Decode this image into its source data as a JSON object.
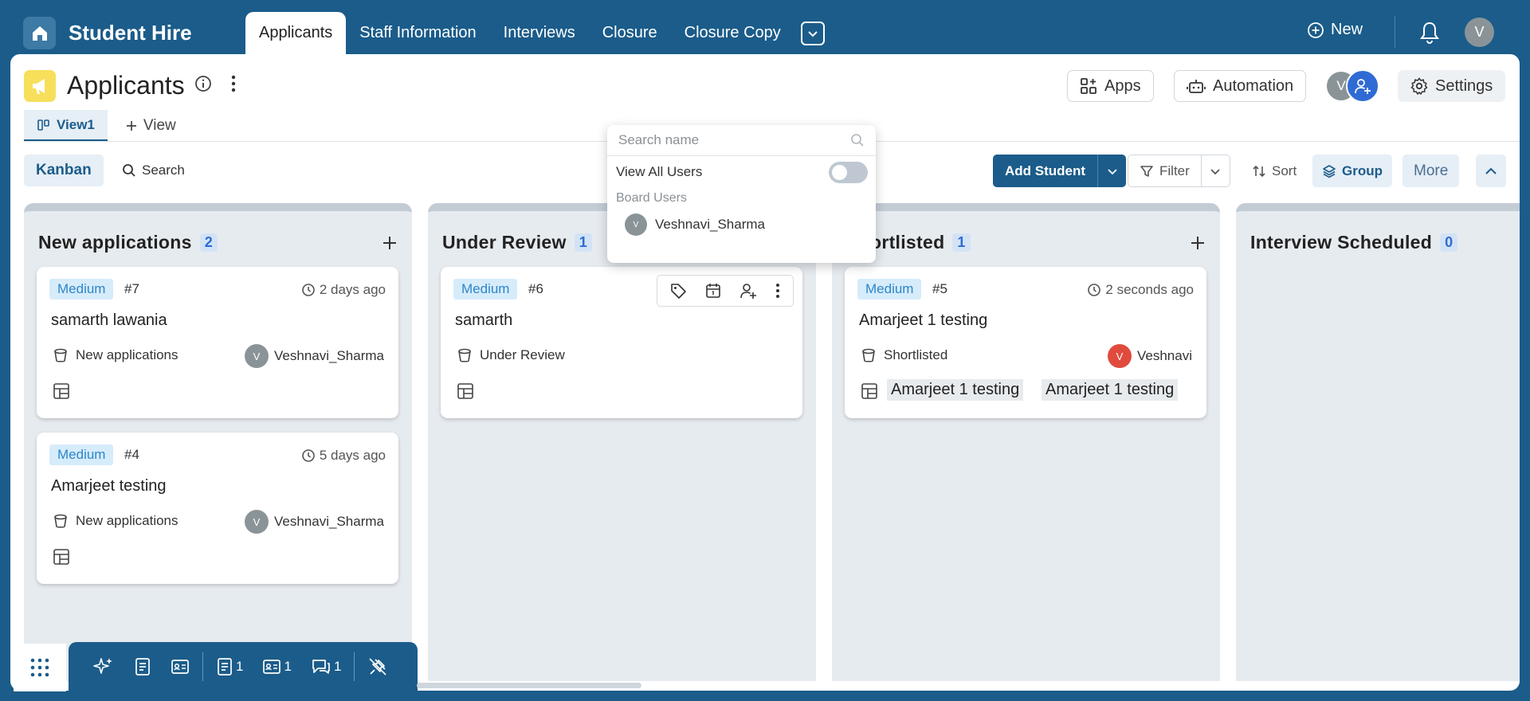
{
  "app": {
    "title": "Student Hire"
  },
  "topnav": {
    "tabs": [
      {
        "label": "Applicants",
        "active": true
      },
      {
        "label": "Staff Information"
      },
      {
        "label": "Interviews"
      },
      {
        "label": "Closure"
      },
      {
        "label": "Closure Copy"
      }
    ],
    "new_label": "New",
    "avatar_initial": "V"
  },
  "page": {
    "title": "Applicants",
    "apps_label": "Apps",
    "automation_label": "Automation",
    "settings_label": "Settings",
    "member_initial": "V"
  },
  "views": {
    "active": "View1",
    "add_label": "View"
  },
  "toolbar": {
    "kanban_label": "Kanban",
    "search_label": "Search",
    "add_student_label": "Add Student",
    "filter_label": "Filter",
    "sort_label": "Sort",
    "group_label": "Group",
    "more_label": "More"
  },
  "user_dropdown": {
    "search_placeholder": "Search name",
    "view_all_label": "View All Users",
    "view_all_on": false,
    "section_label": "Board Users",
    "users": [
      {
        "initial": "V",
        "name": "Veshnavi_Sharma"
      }
    ]
  },
  "columns": [
    {
      "title": "New applications",
      "count": "2",
      "cards": [
        {
          "priority": "Medium",
          "number": "#7",
          "time": "2 days ago",
          "name": "samarth lawania",
          "stage": "New applications",
          "user_initial": "V",
          "user": "Veshnavi_Sharma"
        },
        {
          "priority": "Medium",
          "number": "#4",
          "time": "5 days ago",
          "name": "Amarjeet testing",
          "stage": "New applications",
          "user_initial": "V",
          "user": "Veshnavi_Sharma"
        }
      ]
    },
    {
      "title": "Under Review",
      "count": "1",
      "cards": [
        {
          "priority": "Medium",
          "number": "#6",
          "name": "samarth",
          "stage": "Under Review"
        }
      ]
    },
    {
      "title": "Shortlisted",
      "count": "1",
      "cards": [
        {
          "priority": "Medium",
          "number": "#5",
          "time": "2 seconds ago",
          "name": "Amarjeet 1 testing",
          "stage": "Shortlisted",
          "user_initial": "V",
          "user": "Veshnavi",
          "chips": [
            "Amarjeet 1 testing",
            "Amarjeet 1 testing"
          ]
        }
      ]
    },
    {
      "title": "Interview Scheduled",
      "count": "0",
      "cards": []
    }
  ],
  "bottom_bar": {
    "doc_count": "1",
    "card_count": "1",
    "comment_count": "1"
  },
  "colors": {
    "brand": "#1b5c8a",
    "accent_blue": "#2f6bd4",
    "priority_text": "#2e86c8",
    "avatar_red": "#e04b3d",
    "page_icon_yellow": "#f7df5c"
  },
  "icons": [
    "home-icon",
    "chevron-down-icon",
    "plus-circle-icon",
    "bell-icon",
    "megaphone-icon",
    "info-icon",
    "kebab-icon",
    "apps-icon",
    "robot-icon",
    "add-user-icon",
    "gear-icon",
    "kanban-icon",
    "plus-icon",
    "search-icon",
    "filter-icon",
    "sort-icon",
    "layers-icon",
    "chevron-up-icon",
    "clock-icon",
    "bucket-icon",
    "table-icon",
    "tag-icon",
    "calendar-icon",
    "grid-dots-icon",
    "sparkle-icon",
    "document-icon",
    "id-card-icon",
    "comment-icon",
    "pin-off-icon"
  ]
}
